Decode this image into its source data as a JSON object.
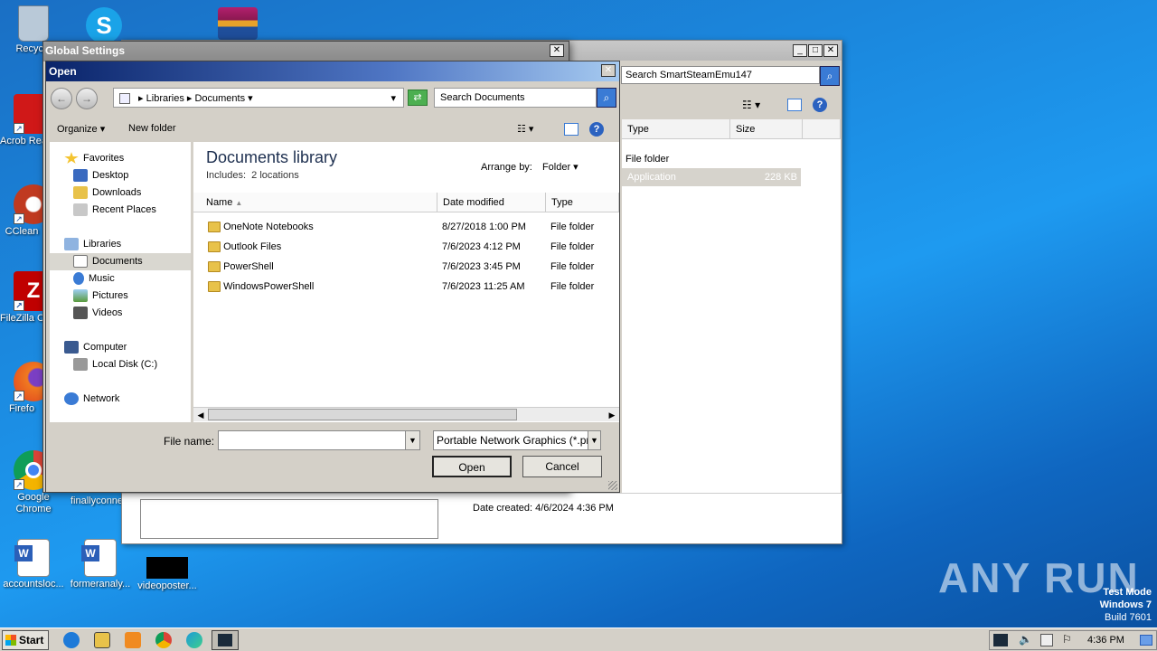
{
  "desktop": {
    "icons": [
      {
        "label": "Recycle",
        "color": "#9fb5c8"
      },
      {
        "label": "Acrob Reader",
        "color": "#d01818"
      },
      {
        "label": "CClean",
        "color": "#c03a20"
      },
      {
        "label": "FileZilla C",
        "color": "#c00000"
      },
      {
        "label": "Firefo",
        "color": "#f07a20"
      },
      {
        "label": "Google Chrome",
        "color": "#3c9a3c"
      },
      {
        "label": "finallyconne",
        "color": "#1e6fcf"
      },
      {
        "label": "accountsloc...",
        "color": "#2b5fb8"
      },
      {
        "label": "formeranaly...",
        "color": "#2b5fb8"
      },
      {
        "label": "videoposter...",
        "color": "#000000"
      }
    ],
    "watermark": "ANY RUN",
    "test_mode": [
      "Test Mode",
      "Windows 7",
      "Build 7601"
    ]
  },
  "back_window": {
    "title": "Global Settings",
    "search_placeholder": "Search SmartSteamEmu147",
    "columns": [
      "Type",
      "Size"
    ],
    "rows": [
      {
        "type": "File folder",
        "size": ""
      },
      {
        "type": "Application",
        "size": "228 KB"
      }
    ],
    "date_created": "Date created: 4/6/2024 4:36 PM"
  },
  "open_dialog": {
    "title": "Open",
    "breadcrumb": [
      "Libraries",
      "Documents"
    ],
    "search_placeholder": "Search Documents",
    "toolbar": {
      "organize": "Organize",
      "new_folder": "New folder"
    },
    "nav": {
      "favorites": "Favorites",
      "desktop": "Desktop",
      "downloads": "Downloads",
      "recent": "Recent Places",
      "libraries": "Libraries",
      "documents": "Documents",
      "music": "Music",
      "pictures": "Pictures",
      "videos": "Videos",
      "computer": "Computer",
      "local_disk": "Local Disk (C:)",
      "network": "Network"
    },
    "library_title": "Documents library",
    "includes": "Includes:",
    "locations": "2 locations",
    "arrange_by": "Arrange by:",
    "arrange_value": "Folder",
    "columns": [
      "Name",
      "Date modified",
      "Type"
    ],
    "files": [
      {
        "name": "OneNote Notebooks",
        "date": "8/27/2018 1:00 PM",
        "type": "File folder"
      },
      {
        "name": "Outlook Files",
        "date": "7/6/2023 4:12 PM",
        "type": "File folder"
      },
      {
        "name": "PowerShell",
        "date": "7/6/2023 3:45 PM",
        "type": "File folder"
      },
      {
        "name": "WindowsPowerShell",
        "date": "7/6/2023 11:25 AM",
        "type": "File folder"
      }
    ],
    "file_name_label": "File name:",
    "file_name_value": "",
    "file_type": "Portable Network Graphics (*.pn",
    "open_btn": "Open",
    "cancel_btn": "Cancel"
  },
  "taskbar": {
    "start": "Start",
    "clock": "4:36 PM"
  }
}
